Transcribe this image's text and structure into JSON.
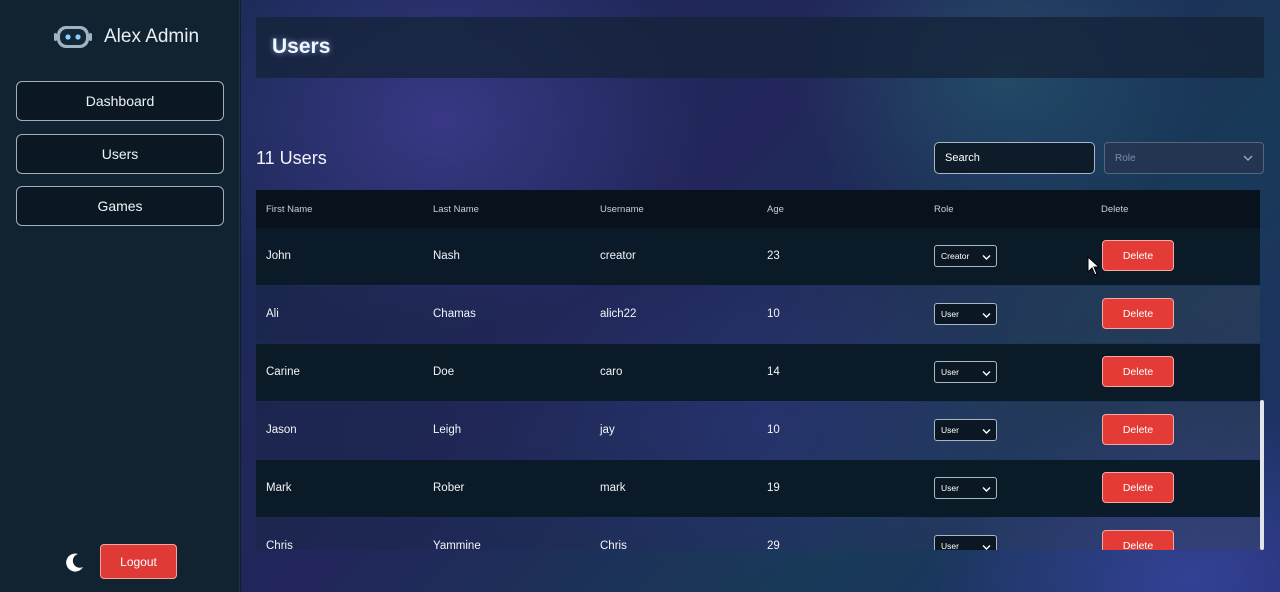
{
  "app": {
    "brand_name": "Alex Admin",
    "brand_icon": "robot-icon"
  },
  "sidebar": {
    "items": [
      {
        "label": "Dashboard"
      },
      {
        "label": "Users"
      },
      {
        "label": "Games"
      }
    ],
    "theme_icon": "moon-icon",
    "logout_label": "Logout"
  },
  "header": {
    "title": "Users"
  },
  "toolbar": {
    "count_label": "11 Users",
    "search_placeholder": "Search",
    "role_filter_placeholder": "Role"
  },
  "table": {
    "columns": [
      "First Name",
      "Last Name",
      "Username",
      "Age",
      "Role",
      "Delete"
    ],
    "rows": [
      {
        "first": "John",
        "last": "Nash",
        "username": "creator",
        "age": "23",
        "role": "Creator",
        "action": "Delete"
      },
      {
        "first": "Ali",
        "last": "Chamas",
        "username": "alich22",
        "age": "10",
        "role": "User",
        "action": "Delete"
      },
      {
        "first": "Carine",
        "last": "Doe",
        "username": "caro",
        "age": "14",
        "role": "User",
        "action": "Delete"
      },
      {
        "first": "Jason",
        "last": "Leigh",
        "username": "jay",
        "age": "10",
        "role": "User",
        "action": "Delete"
      },
      {
        "first": "Mark",
        "last": "Rober",
        "username": "mark",
        "age": "19",
        "role": "User",
        "action": "Delete"
      },
      {
        "first": "Chris",
        "last": "Yammine",
        "username": "Chris",
        "age": "29",
        "role": "User",
        "action": "Delete"
      }
    ]
  },
  "colors": {
    "accent_red": "#e43b36",
    "sidebar_bg": "#112231",
    "table_header_bg": "#07121c"
  }
}
